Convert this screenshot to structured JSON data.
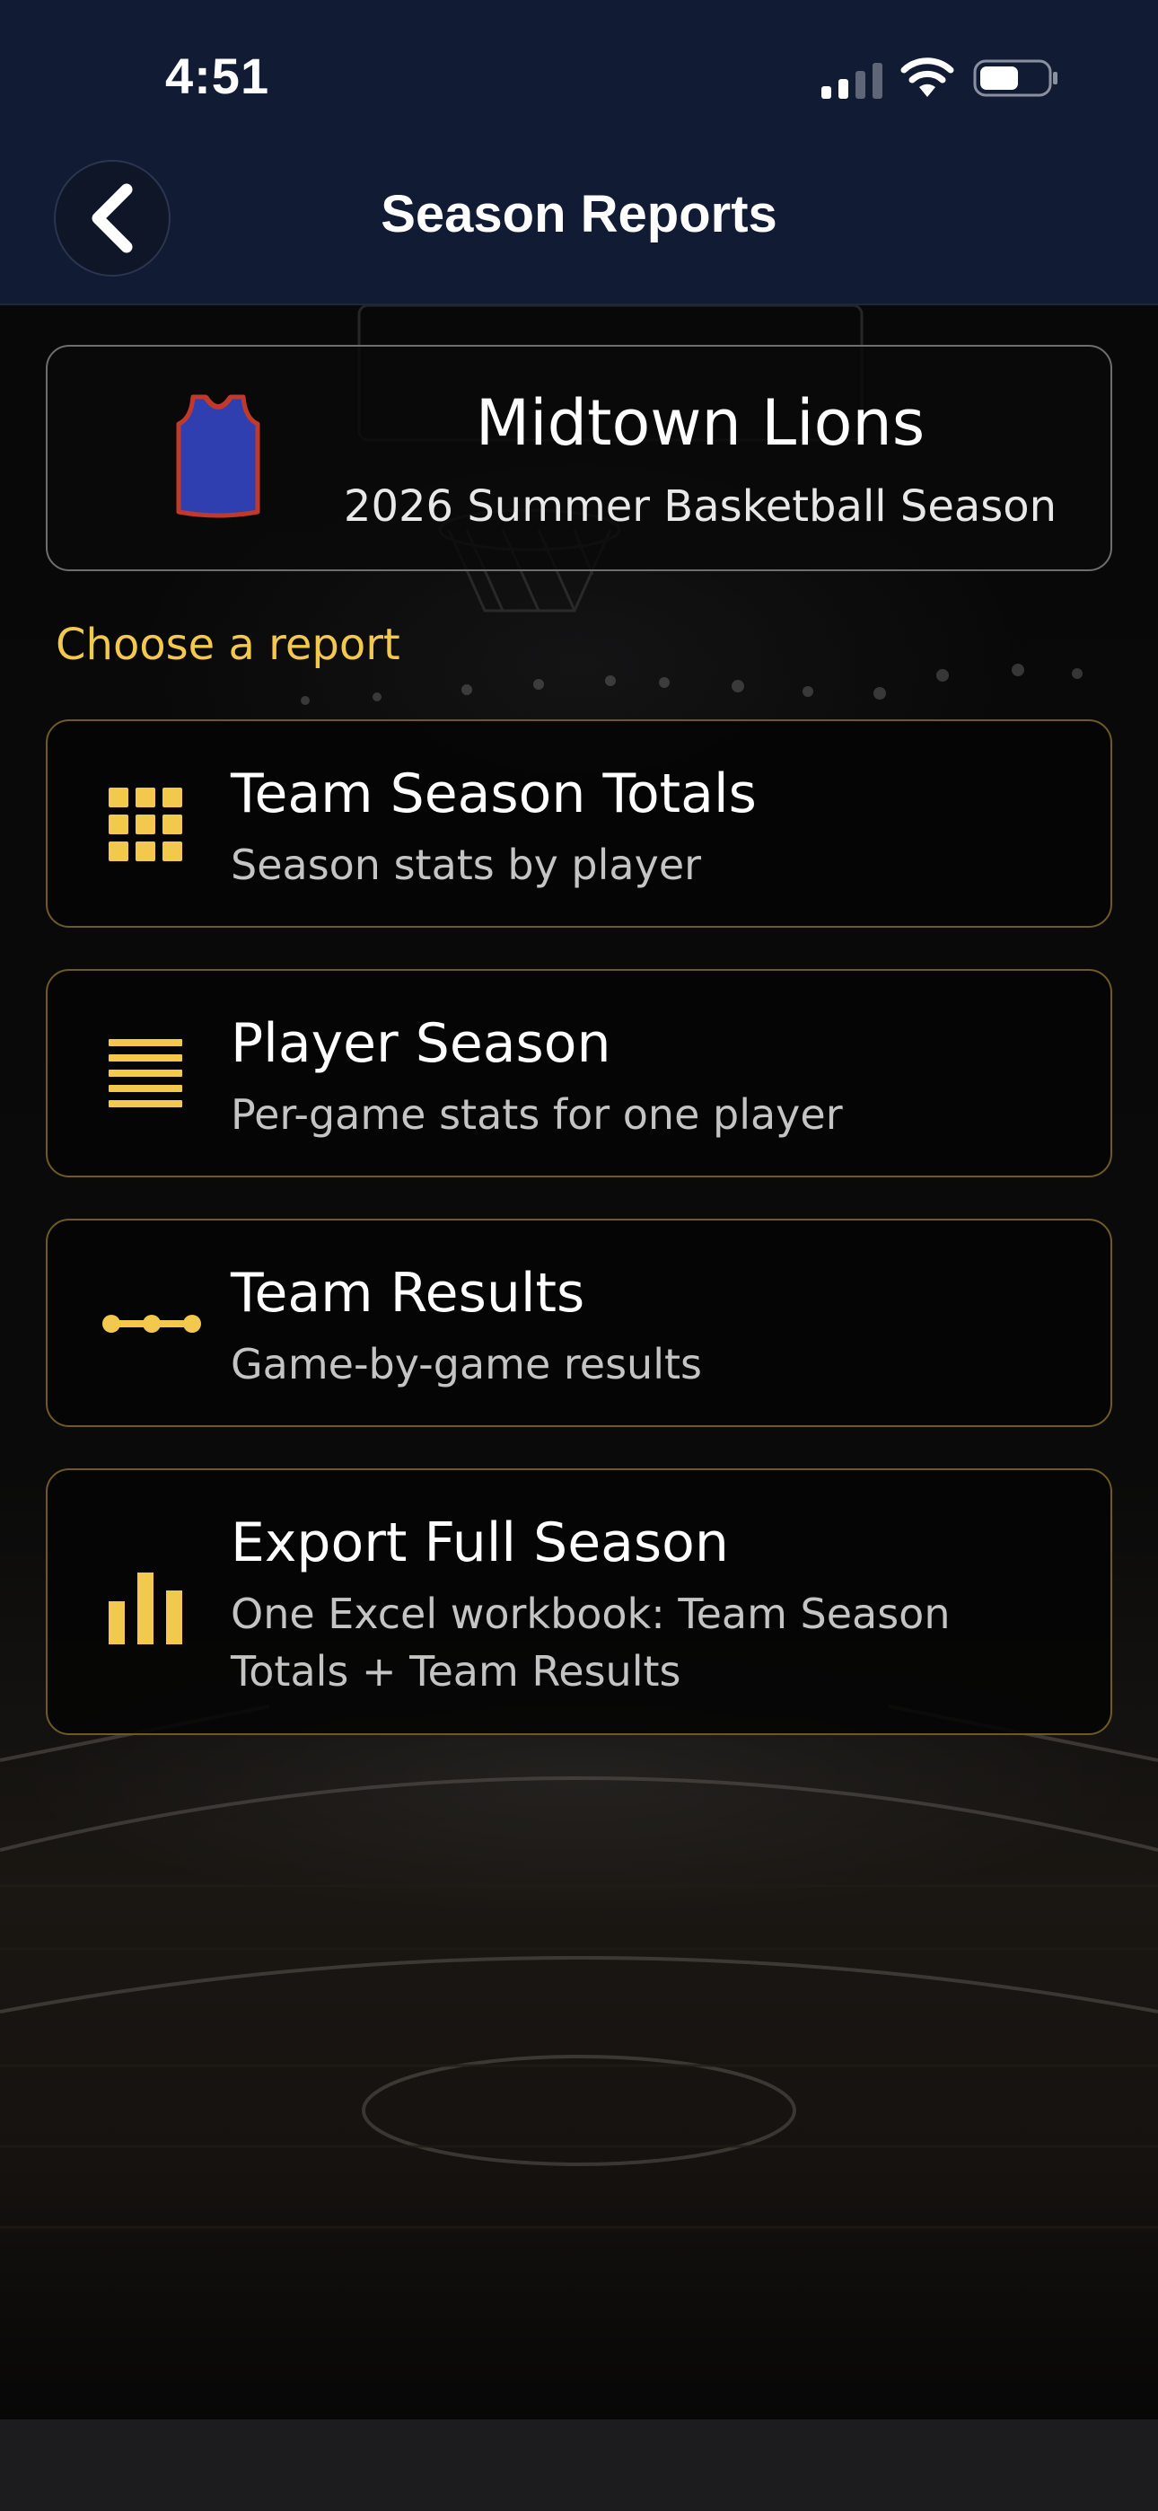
{
  "status_bar": {
    "time": "4:51"
  },
  "header": {
    "title": "Season Reports",
    "back_icon": "chevron-left-icon"
  },
  "team": {
    "name": "Midtown Lions",
    "season": "2026 Summer Basketball Season",
    "jersey_color": "#2f3fb0",
    "jersey_trim_color": "#c0392b"
  },
  "section_label": "Choose a report",
  "accent_color": "#f2c94c",
  "reports": [
    {
      "title": "Team Season Totals",
      "subtitle": "Season stats by player",
      "icon": "grid-icon"
    },
    {
      "title": "Player Season",
      "subtitle": "Per-game stats for one player",
      "icon": "list-lines-icon"
    },
    {
      "title": "Team Results",
      "subtitle": "Game-by-game results",
      "icon": "timeline-icon"
    },
    {
      "title": "Export Full Season",
      "subtitle": "One Excel workbook: Team Season Totals + Team Results",
      "icon": "bar-chart-icon"
    }
  ]
}
